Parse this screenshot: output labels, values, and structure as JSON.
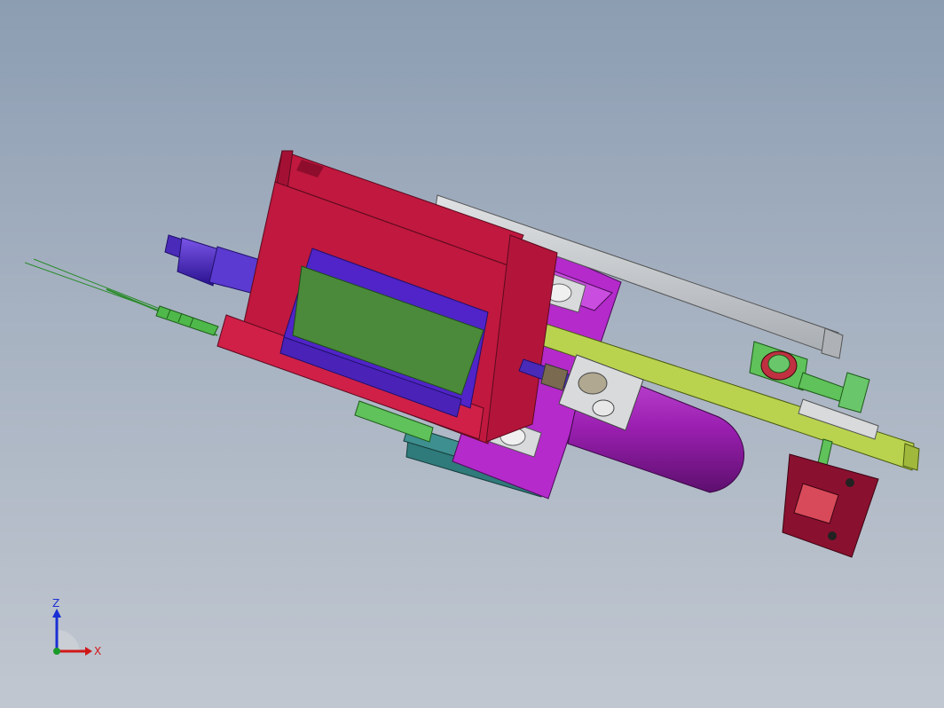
{
  "viewport": {
    "background_top": "#8c9db2",
    "background_bottom": "#c1c7d0"
  },
  "triad": {
    "z_label": "Z",
    "x_label": "X",
    "z_color": "#1a2fd4",
    "x_color": "#d01818",
    "y_color": "#1a9a2a"
  },
  "parts": {
    "cylinder_frame_color": "#c0183e",
    "cylinder_tube_color": "#5024c8",
    "cylinder_core_color": "#4a8a3a",
    "mount_plate_color": "#b42acb",
    "guide_rail_color": "#c8cccf",
    "lever_arm_color": "#b9d34f",
    "base_plate_color": "#3e8f8f",
    "accumulator_color": "#9a1fb0",
    "bracket_color": "#8a1030",
    "pin_color": "#5fc25a"
  }
}
